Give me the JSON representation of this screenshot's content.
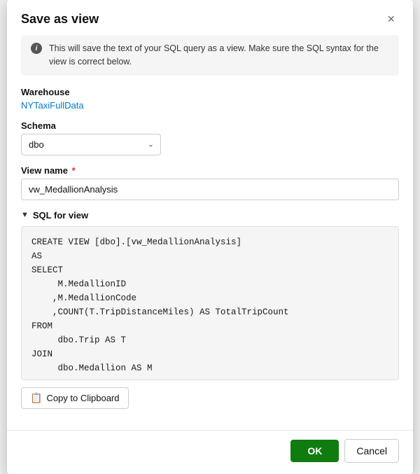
{
  "dialog": {
    "title": "Save as view",
    "close_label": "×"
  },
  "info_banner": {
    "text": "This will save the text of your SQL query as a view. Make sure the SQL syntax for the view is correct below."
  },
  "warehouse_section": {
    "label": "Warehouse",
    "link_text": "NYTaxiFullData"
  },
  "schema_section": {
    "label": "Schema",
    "value": "dbo",
    "options": [
      "dbo"
    ]
  },
  "view_name_section": {
    "label": "View name",
    "required": true,
    "value": "vw_MedallionAnalysis"
  },
  "sql_section": {
    "label": "SQL for view",
    "code": "CREATE VIEW [dbo].[vw_MedallionAnalysis]\nAS\nSELECT\n     M.MedallionID\n    ,M.MedallionCode\n    ,COUNT(T.TripDistanceMiles) AS TotalTripCount\nFROM\n     dbo.Trip AS T\nJOIN\n     dbo.Medallion AS M"
  },
  "clipboard_button": {
    "label": "Copy to Clipboard"
  },
  "footer": {
    "ok_label": "OK",
    "cancel_label": "Cancel"
  }
}
